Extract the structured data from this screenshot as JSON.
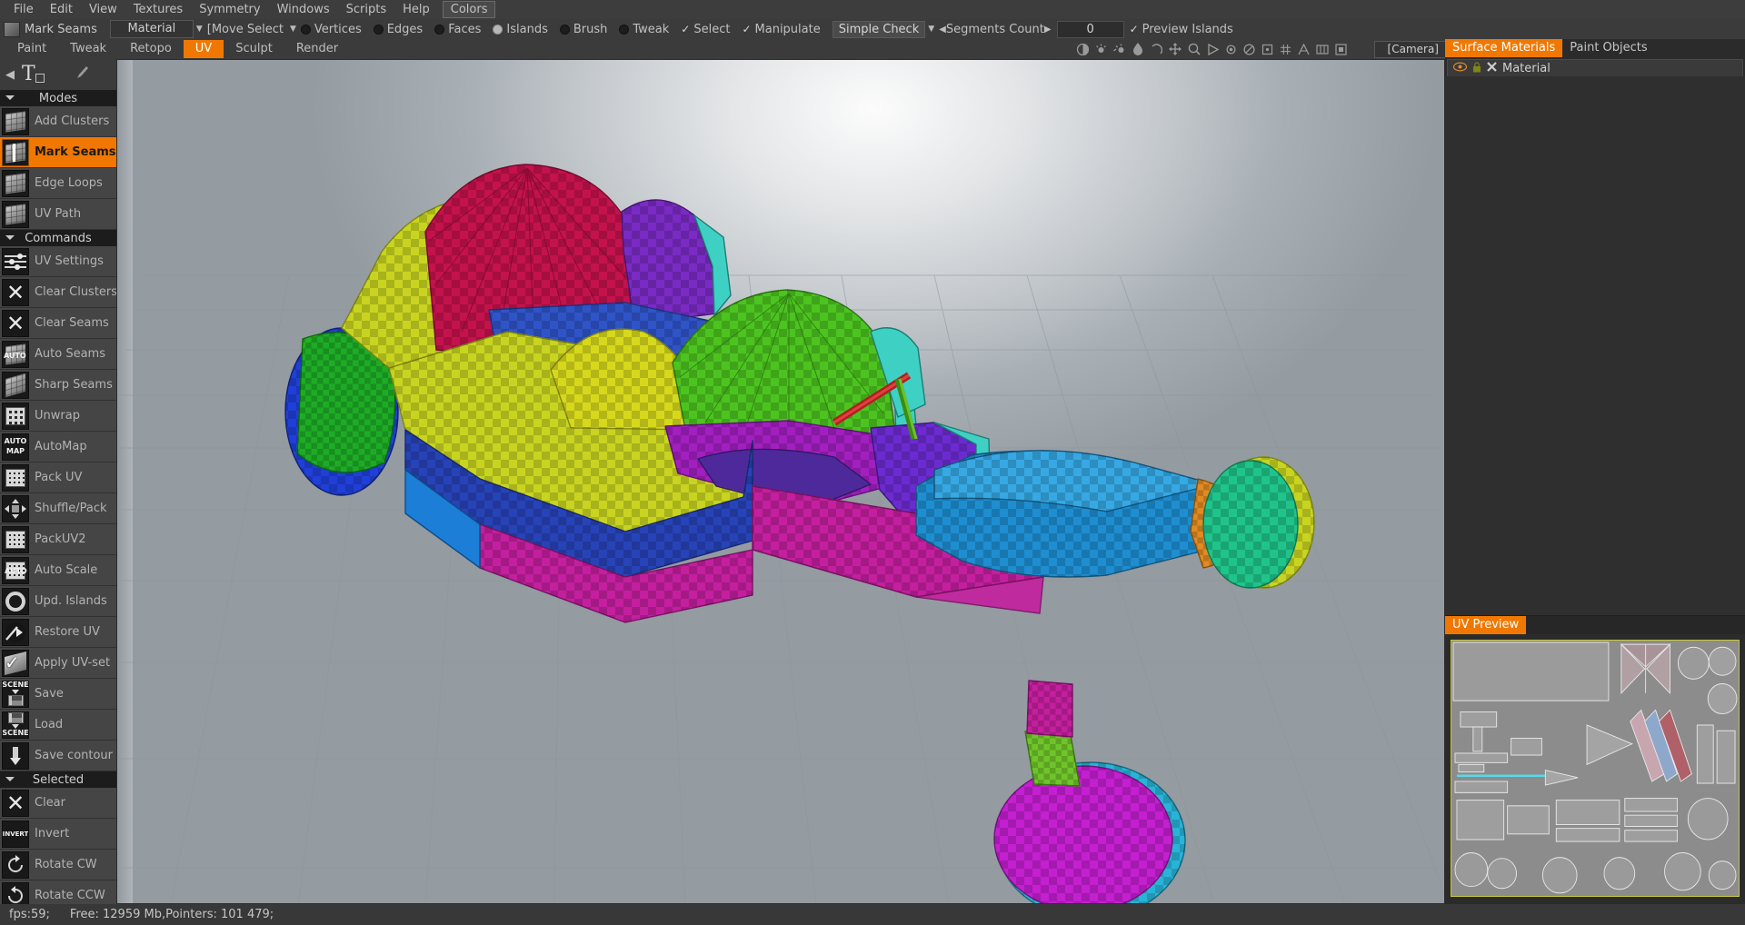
{
  "menubar": {
    "items": [
      "File",
      "Edit",
      "View",
      "Textures",
      "Symmetry",
      "Windows",
      "Scripts",
      "Help"
    ],
    "boxed_item": "Colors"
  },
  "toolrow": {
    "tool_name": "Mark Seams",
    "material_combo": "Material",
    "move_select_combo": "[Move Select",
    "radios": [
      {
        "label": "Vertices",
        "selected": false
      },
      {
        "label": "Edges",
        "selected": false
      },
      {
        "label": "Faces",
        "selected": false
      },
      {
        "label": "Islands",
        "selected": true
      },
      {
        "label": "Brush",
        "selected": false
      },
      {
        "label": "Tweak",
        "selected": false
      }
    ],
    "checks": [
      {
        "label": "Select",
        "checked": true
      },
      {
        "label": "Manipulate",
        "checked": true
      }
    ],
    "mode_pill": "Simple Check",
    "segments_count_label": "Segments Count",
    "segments_count_value": "0",
    "preview_islands": {
      "label": "Preview Islands",
      "checked": true
    }
  },
  "tabrow": {
    "tabs": [
      {
        "label": "Paint",
        "active": false
      },
      {
        "label": "Tweak",
        "active": false
      },
      {
        "label": "Retopo",
        "active": false
      },
      {
        "label": "UV",
        "active": true
      },
      {
        "label": "Sculpt",
        "active": false
      },
      {
        "label": "Render",
        "active": false
      }
    ],
    "camera_select": "[Camera]",
    "viewport_icons": [
      "contrast-icon",
      "light-icon",
      "light-move-icon",
      "drop-icon",
      "undo-icon",
      "pan-icon",
      "zoom-icon",
      "play-icon",
      "record-icon",
      "no-icon",
      "snap-icon",
      "grid-icon",
      "measure-icon",
      "crop-icon",
      "fullscreen-icon"
    ]
  },
  "sidebar": {
    "tool_title_icon": "text-tool-icon",
    "groups": [
      {
        "title": "Modes",
        "items": [
          {
            "label": "Add Clusters",
            "icon": "cube-cluster-icon",
            "active": false
          },
          {
            "label": "Mark Seams",
            "icon": "cube-seam-icon",
            "active": true
          },
          {
            "label": "Edge Loops",
            "icon": "cube-loop-icon",
            "active": false
          },
          {
            "label": "UV Path",
            "icon": "cube-path-icon",
            "active": false
          }
        ]
      },
      {
        "title": "Commands",
        "items": [
          {
            "label": "UV Settings",
            "icon": "sliders-icon",
            "active": false
          },
          {
            "label": "Clear Clusters",
            "icon": "x-cube-icon",
            "active": false
          },
          {
            "label": "Clear Seams",
            "icon": "x-icon",
            "active": false
          },
          {
            "label": "Auto Seams",
            "icon": "auto-cube-icon",
            "active": false
          },
          {
            "label": "Sharp Seams",
            "icon": "sharp-cube-icon",
            "active": false
          },
          {
            "label": "Unwrap",
            "icon": "grid-icon",
            "active": false
          },
          {
            "label": "AutoMap",
            "icon": "automap-icon",
            "active": false
          },
          {
            "label": "Pack UV",
            "icon": "pack-uv-icon",
            "active": false
          },
          {
            "label": "Shuffle/Pack",
            "icon": "shuffle-pack-icon",
            "active": false
          },
          {
            "label": "PackUV2",
            "icon": "packuv2-icon",
            "active": false
          },
          {
            "label": "Auto Scale",
            "icon": "auto-scale-icon",
            "active": false
          },
          {
            "label": "Upd. Islands",
            "icon": "update-islands-icon",
            "active": false
          },
          {
            "label": "Restore UV",
            "icon": "restore-uv-icon",
            "active": false
          },
          {
            "label": "Apply UV-set",
            "icon": "apply-uvset-icon",
            "active": false
          },
          {
            "label": "Save",
            "icon": "save-scene-icon",
            "active": false
          },
          {
            "label": "Load",
            "icon": "load-scene-icon",
            "active": false
          },
          {
            "label": "Save contour",
            "icon": "save-contour-icon",
            "active": false
          }
        ]
      },
      {
        "title": "Selected",
        "items": [
          {
            "label": "Clear",
            "icon": "x-icon",
            "active": false
          },
          {
            "label": "Invert",
            "icon": "invert-icon",
            "active": false
          },
          {
            "label": "Rotate CW",
            "icon": "rotate-cw-icon",
            "active": false
          },
          {
            "label": "Rotate CCW",
            "icon": "rotate-ccw-icon",
            "active": false
          }
        ]
      }
    ]
  },
  "right_panel": {
    "tabs": [
      {
        "label": "Surface Materials",
        "active": true
      },
      {
        "label": "Paint Objects",
        "active": false
      }
    ],
    "material_rows": [
      {
        "name": "Material",
        "eye": "eye-icon",
        "lock": "lock-icon",
        "close": "x-icon"
      }
    ],
    "uv_preview": {
      "tab_label": "UV Preview"
    }
  },
  "statusbar": {
    "fps": "fps:59;",
    "free_memory": "Free: 12959 Mb,Pointers: 101 479;"
  },
  "colors": {
    "accent": "#f07800",
    "panel_bg": "#3b3b3b",
    "dark_bg": "#2b2b2b",
    "text": "#b9b9b9",
    "uv_preview_border": "#c8c83c"
  }
}
